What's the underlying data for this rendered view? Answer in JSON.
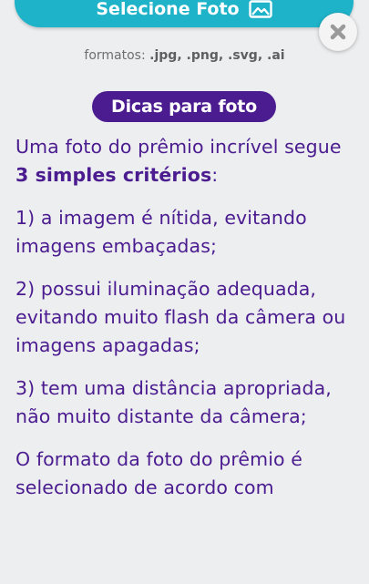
{
  "select_button": {
    "label": "Selecione Foto",
    "icon": "image-icon",
    "color": "#1fb3c9"
  },
  "close_button": {
    "icon": "close-icon"
  },
  "formats": {
    "prefix": "formatos: ",
    "extensions": ".jpg, .png, .svg, .ai"
  },
  "tips": {
    "badge_label": "Dicas para foto",
    "badge_color": "#4b1c8f",
    "intro_before": "Uma foto do prêmio incrível segue ",
    "intro_bold": "3 simples critérios",
    "intro_after": ":",
    "criteria": [
      "1) a imagem é nítida, evitando imagens embaçadas;",
      "2) possui iluminação adequada, evitando muito flash da câmera ou imagens apagadas;",
      "3) tem uma distância apropriada, não muito distante da câmera;"
    ],
    "closing_partial": "O formato da foto do prêmio é selecionado de acordo com"
  }
}
